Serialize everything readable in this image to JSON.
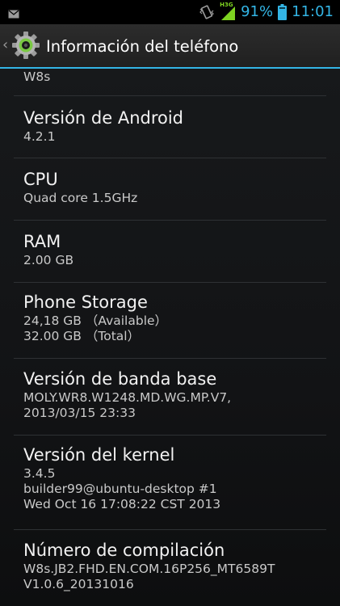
{
  "status_bar": {
    "network_type": "H3G",
    "battery_percent": "91%",
    "time": "11:01",
    "accent_color": "#33b5e5"
  },
  "action_bar": {
    "title": "Información del teléfono",
    "icon": "settings-gear-icon"
  },
  "items": [
    {
      "title": "",
      "summary": [
        "W8s"
      ]
    },
    {
      "title": "Versión de Android",
      "summary": [
        "4.2.1"
      ]
    },
    {
      "title": "CPU",
      "summary": [
        "Quad core 1.5GHz"
      ]
    },
    {
      "title": "RAM",
      "summary": [
        "2.00 GB"
      ]
    },
    {
      "title": "Phone Storage",
      "summary": [
        "24,18 GB （Available）",
        "32.00 GB （Total）"
      ]
    },
    {
      "title": "Versión de banda base",
      "summary": [
        "MOLY.WR8.W1248.MD.WG.MP.V7,",
        "2013/03/15 23:33"
      ]
    },
    {
      "title": "Versión del kernel",
      "summary": [
        "3.4.5",
        "builder99@ubuntu-desktop #1",
        "Wed Oct 16 17:08:22 CST 2013"
      ]
    },
    {
      "title": "Número de compilación",
      "summary": [
        "W8s.JB2.FHD.EN.COM.16P256_MT6589T",
        "V1.0.6_20131016"
      ]
    }
  ]
}
